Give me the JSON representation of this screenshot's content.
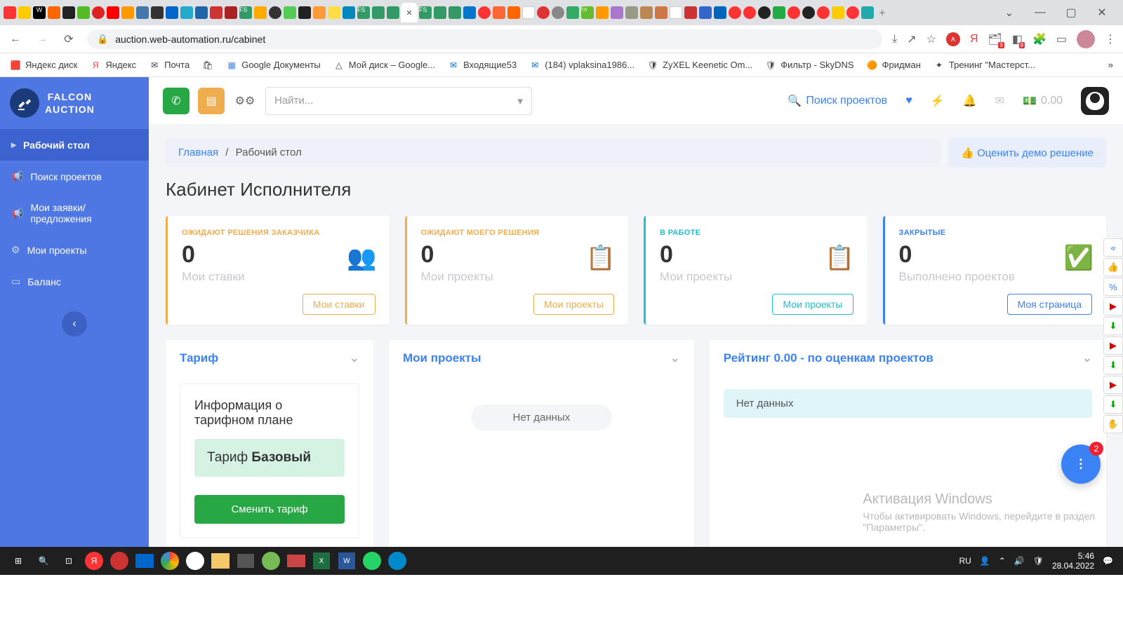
{
  "browser": {
    "url": "auction.web-automation.ru/cabinet",
    "bookmarks": {
      "b1": "Яндекс диск",
      "b2": "Яндекс",
      "b3": "Почта",
      "b4": "Google Документы",
      "b5": "Мой диск – Google...",
      "b6": "Входящие53",
      "b7": "(184) vplaksina1986...",
      "b8": "ZyXEL Keenetic Om...",
      "b9": "Фильтр - SkyDNS",
      "b10": "Фридман",
      "b11": "Тренинг \"Мастерст..."
    }
  },
  "logo": {
    "line1": "FALCON",
    "line2": "AUCTION"
  },
  "sidebar": {
    "desk": "Рабочий стол",
    "search": "Поиск проектов",
    "bids": "Мои заявки/предложения",
    "projects": "Мои проекты",
    "balance": "Баланс"
  },
  "topbar": {
    "search_placeholder": "Найти...",
    "project_search": "Поиск проектов",
    "wallet": "0.00"
  },
  "breadcrumb": {
    "home": "Главная",
    "sep": "/",
    "current": "Рабочий стол"
  },
  "rate_btn": "Оценить демо решение",
  "page_title": "Кабинет Исполнителя",
  "cards": {
    "c1": {
      "label": "ОЖИДАЮТ РЕШЕНИЯ ЗАКАЗЧИКА",
      "value": "0",
      "sub": "Мои ставки",
      "btn": "Мои ставки"
    },
    "c2": {
      "label": "ОЖИДАЮТ МОЕГО РЕШЕНИЯ",
      "value": "0",
      "sub": "Мои проекты",
      "btn": "Мои проекты"
    },
    "c3": {
      "label": "В РАБОТЕ",
      "value": "0",
      "sub": "Мои проекты",
      "btn": "Мои проекты"
    },
    "c4": {
      "label": "ЗАКРЫТЫЕ",
      "value": "0",
      "sub": "Выполнено проектов",
      "btn": "Моя страница"
    }
  },
  "panels": {
    "p1": {
      "title": "Тариф",
      "info": "Информация о тарифном плане",
      "badge_pre": "Тариф ",
      "badge_bold": "Базовый",
      "btn": "Сменить тариф"
    },
    "p2": {
      "title": "Мои проекты",
      "nodata": "Нет данных"
    },
    "p3": {
      "title": "Рейтинг 0.00 - по оценкам проектов",
      "nodata": "Нет данных"
    }
  },
  "activation": {
    "t1": "Активация Windows",
    "t2": "Чтобы активировать Windows, перейдите в раздел",
    "t3": "\"Параметры\"."
  },
  "fab_badge": "2",
  "taskbar": {
    "lang": "RU",
    "time": "5:46",
    "date": "28.04.2022"
  }
}
